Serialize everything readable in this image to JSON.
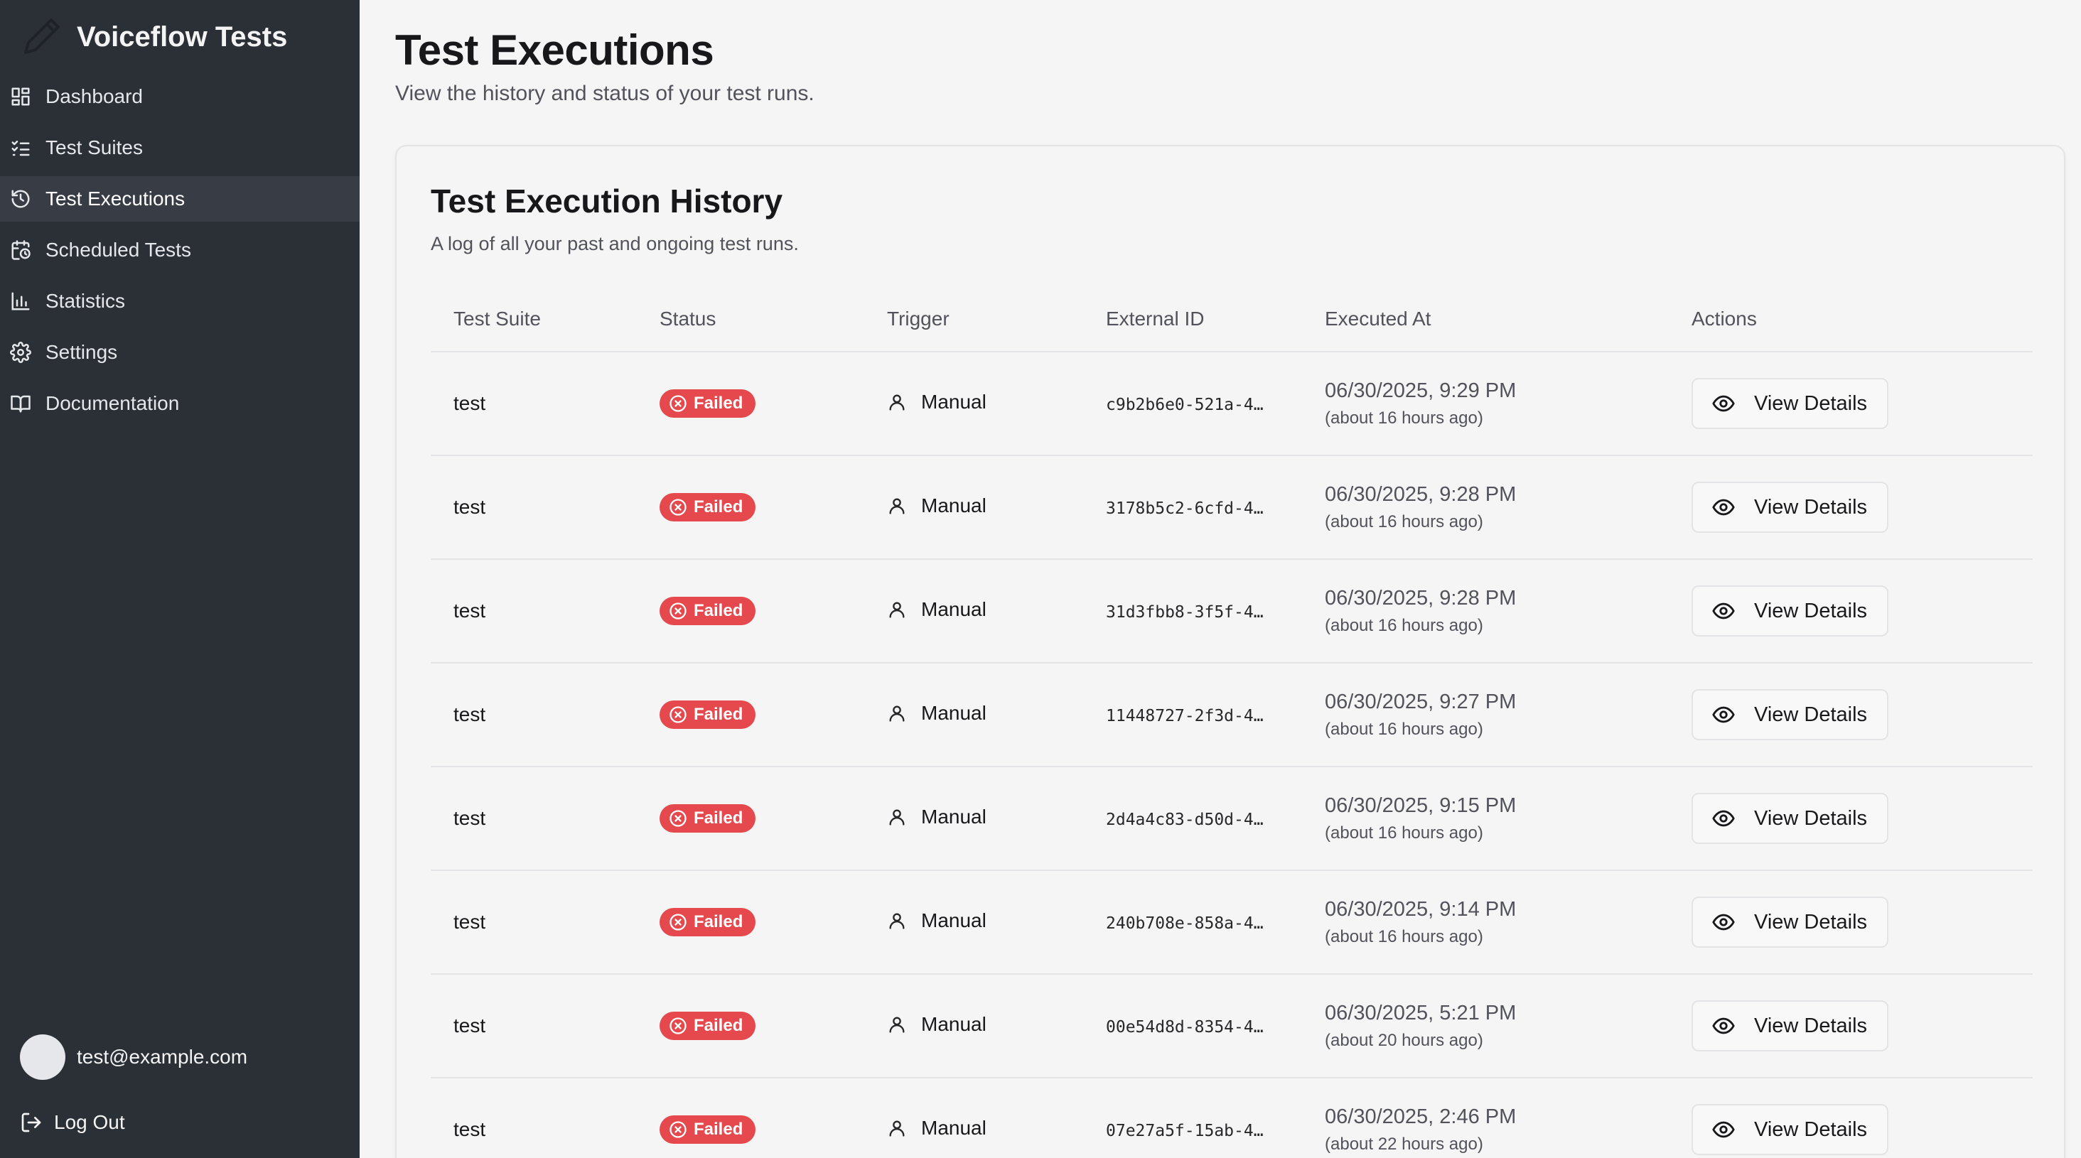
{
  "app": {
    "title": "Voiceflow Tests"
  },
  "sidebar": {
    "items": [
      {
        "label": "Dashboard",
        "icon": "dashboard-icon",
        "active": false
      },
      {
        "label": "Test Suites",
        "icon": "list-checks-icon",
        "active": false
      },
      {
        "label": "Test Executions",
        "icon": "history-icon",
        "active": true
      },
      {
        "label": "Scheduled Tests",
        "icon": "calendar-clock-icon",
        "active": false
      },
      {
        "label": "Statistics",
        "icon": "bar-chart-icon",
        "active": false
      },
      {
        "label": "Settings",
        "icon": "gear-icon",
        "active": false
      },
      {
        "label": "Documentation",
        "icon": "book-icon",
        "active": false
      }
    ],
    "user_email": "test@example.com",
    "logout_label": "Log Out"
  },
  "page": {
    "title": "Test Executions",
    "subtitle": "View the history and status of your test runs."
  },
  "card": {
    "title": "Test Execution History",
    "subtitle": "A log of all your past and ongoing test runs."
  },
  "table": {
    "headers": [
      "Test Suite",
      "Status",
      "Trigger",
      "External ID",
      "Executed At",
      "Actions"
    ],
    "rows": [
      {
        "suite": "test",
        "status": "Failed",
        "trigger": "Manual",
        "external_id": "c9b2b6e0-521a-4…",
        "executed_at": "06/30/2025, 9:29 PM",
        "relative": "(about 16 hours ago)",
        "action": "View Details"
      },
      {
        "suite": "test",
        "status": "Failed",
        "trigger": "Manual",
        "external_id": "3178b5c2-6cfd-4…",
        "executed_at": "06/30/2025, 9:28 PM",
        "relative": "(about 16 hours ago)",
        "action": "View Details"
      },
      {
        "suite": "test",
        "status": "Failed",
        "trigger": "Manual",
        "external_id": "31d3fbb8-3f5f-4…",
        "executed_at": "06/30/2025, 9:28 PM",
        "relative": "(about 16 hours ago)",
        "action": "View Details"
      },
      {
        "suite": "test",
        "status": "Failed",
        "trigger": "Manual",
        "external_id": "11448727-2f3d-4…",
        "executed_at": "06/30/2025, 9:27 PM",
        "relative": "(about 16 hours ago)",
        "action": "View Details"
      },
      {
        "suite": "test",
        "status": "Failed",
        "trigger": "Manual",
        "external_id": "2d4a4c83-d50d-4…",
        "executed_at": "06/30/2025, 9:15 PM",
        "relative": "(about 16 hours ago)",
        "action": "View Details"
      },
      {
        "suite": "test",
        "status": "Failed",
        "trigger": "Manual",
        "external_id": "240b708e-858a-4…",
        "executed_at": "06/30/2025, 9:14 PM",
        "relative": "(about 16 hours ago)",
        "action": "View Details"
      },
      {
        "suite": "test",
        "status": "Failed",
        "trigger": "Manual",
        "external_id": "00e54d8d-8354-4…",
        "executed_at": "06/30/2025, 5:21 PM",
        "relative": "(about 20 hours ago)",
        "action": "View Details"
      },
      {
        "suite": "test",
        "status": "Failed",
        "trigger": "Manual",
        "external_id": "07e27a5f-15ab-4…",
        "executed_at": "06/30/2025, 2:46 PM",
        "relative": "(about 22 hours ago)",
        "action": "View Details"
      }
    ]
  },
  "colors": {
    "sidebar_bg": "#2b2f36",
    "sidebar_active": "#383c44",
    "failed_badge": "#e5484d",
    "page_bg": "#f5f5f5"
  }
}
